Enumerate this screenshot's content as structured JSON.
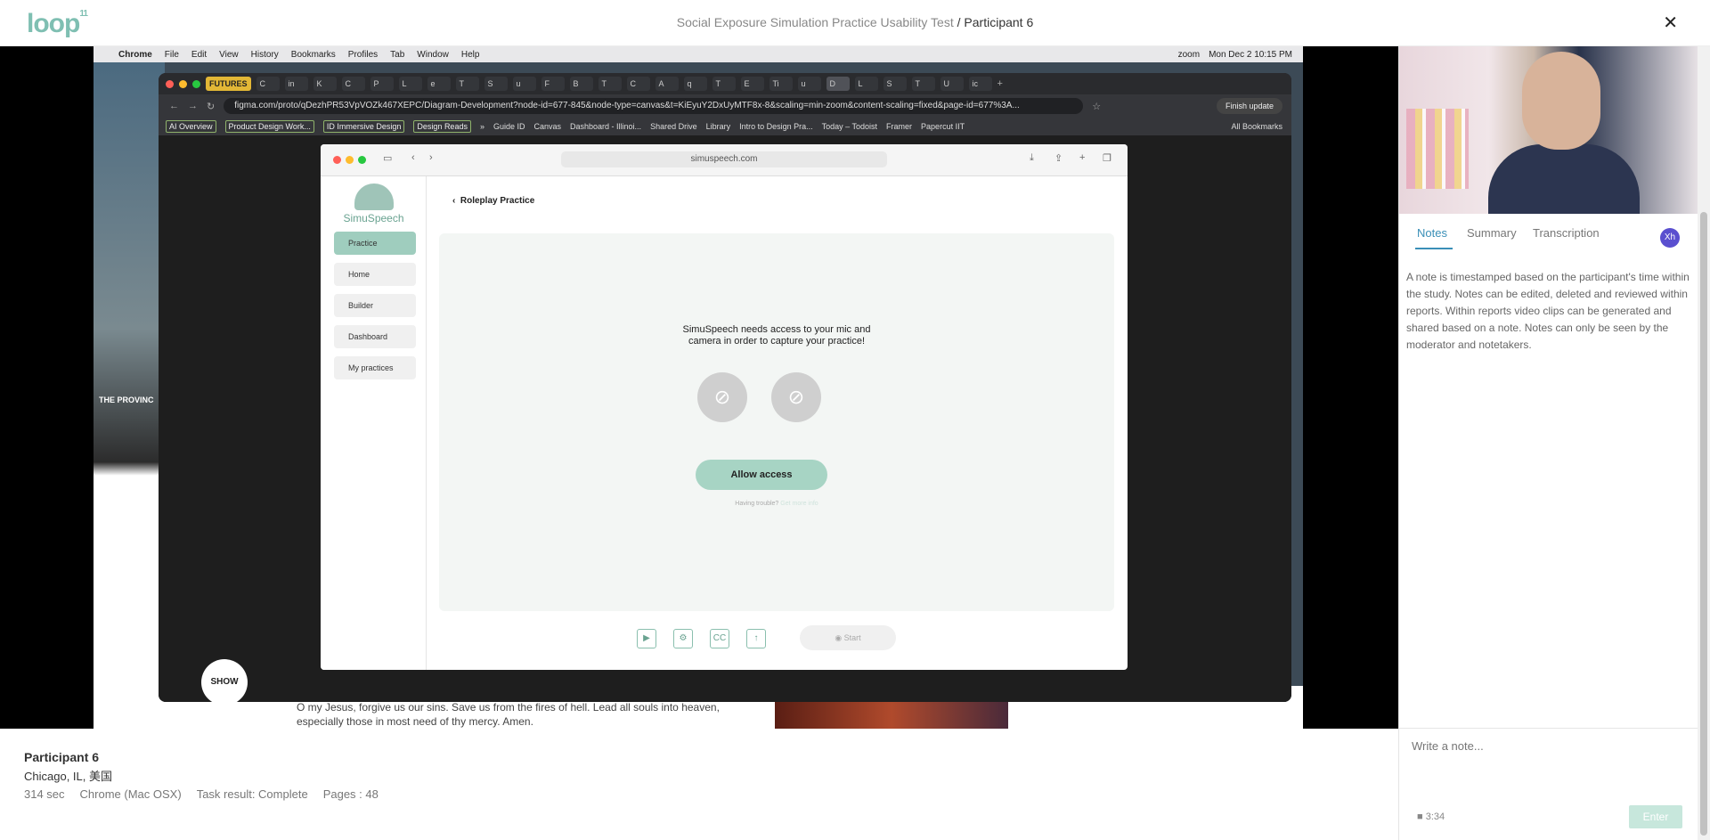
{
  "app": {
    "logo": "loop",
    "logo_sup": "11",
    "study_title": "Social Exposure Simulation Practice Usability Test",
    "separator": " / ",
    "participant_title": "Participant 6",
    "close_icon": "close-icon"
  },
  "recording": {
    "mac_menu": [
      "Chrome",
      "File",
      "Edit",
      "View",
      "History",
      "Bookmarks",
      "Profiles",
      "Tab",
      "Window",
      "Help"
    ],
    "mac_status": [
      "zoom",
      "Mon Dec 2  10:15 PM"
    ],
    "tabs": [
      "FUTURES",
      "C",
      "in",
      "K",
      "C",
      "P",
      "L",
      "e",
      "T",
      "S",
      "u",
      "F",
      "B",
      "T",
      "C",
      "A",
      "q",
      "T",
      "E",
      "Ti",
      "u",
      "D",
      "L",
      "S",
      "T",
      "U",
      "ic"
    ],
    "url": "figma.com/proto/qDezhPR53VpVOZk467XEPC/Diagram-Development?node-id=677-845&node-type=canvas&t=KiEyuY2DxUyMTF8x-8&scaling=min-zoom&content-scaling=fixed&page-id=677%3A...",
    "finish_update": "Finish update",
    "bookmarks_boxed": [
      "AI Overview",
      "Product Design Work...",
      "ID Immersive Design",
      "Design Reads"
    ],
    "bookmarks": [
      "Guide ID",
      "Canvas",
      "Dashboard - Illinoi...",
      "Shared Drive",
      "Library",
      "Intro to Design Pra...",
      "Today – Todoist",
      "Framer",
      "Papercut IIT"
    ],
    "all_bookmarks": "All Bookmarks",
    "province": "THE PROVINC",
    "background_text": "O my Jesus, forgive us our sins. Save us from the fires of hell. Lead all souls into heaven, especially those in most need of thy mercy. Amen.",
    "safari_url": "simuspeech.com",
    "brand": "SimuSpeech",
    "sidebar": [
      "Practice",
      "Home",
      "Builder",
      "Dashboard",
      "My practices"
    ],
    "back_label": "Roleplay Practice",
    "permission_msg_1": "SimuSpeech needs access to your mic and",
    "permission_msg_2": "camera in order to capture your practice!",
    "allow_access": "Allow access",
    "having_trouble": "Having trouble?",
    "get_more_info": "Get more info",
    "start": "Start",
    "show": "SHOW"
  },
  "participant": {
    "name": "Participant 6",
    "location": "Chicago, IL, 美国",
    "duration": "314 sec",
    "browser": "Chrome (Mac OSX)",
    "task_result": "Task result: Complete",
    "pages": "Pages : 48"
  },
  "panel": {
    "tabs": [
      "Notes",
      "Summary",
      "Transcription"
    ],
    "active_tab": "Notes",
    "avatar": "Xh",
    "hint": "A note is timestamped based on the participant's time within the study. Notes can be edited, deleted and reviewed within reports. Within reports video clips can be generated and shared based on a note. Notes can only be seen by the moderator and notetakers.",
    "note_placeholder": "Write a note...",
    "timestamp": "3:34",
    "enter": "Enter"
  },
  "colors": {
    "accent": "#3a8fb7",
    "brand_green": "#7fbfb2",
    "allow_button": "#a7d4c4",
    "enter_button": "#c7e7dc"
  }
}
